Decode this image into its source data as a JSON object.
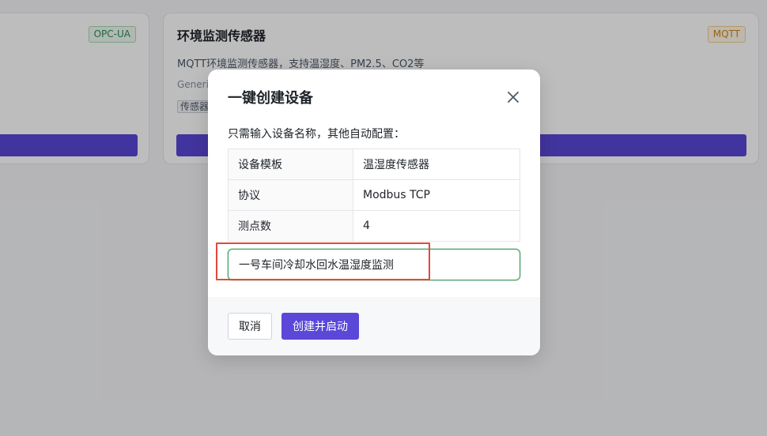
{
  "background_cards": [
    {
      "title": "",
      "badge": "OPC-UA"
    },
    {
      "title": "环境监测传感器",
      "badge": "MQTT",
      "description": "MQTT环境监测传感器，支持温湿度、PM2.5、CO2等",
      "vendor": "Generic",
      "tag": "传感器"
    }
  ],
  "modal": {
    "title": "一键创建设备",
    "close_icon": "close-icon",
    "hint": "只需输入设备名称，其他自动配置：",
    "info_rows": [
      {
        "key": "设备模板",
        "value": "温湿度传感器"
      },
      {
        "key": "协议",
        "value": "Modbus TCP"
      },
      {
        "key": "测点数",
        "value": "4"
      }
    ],
    "device_name_value": "一号车间冷却水回水温湿度监测",
    "cancel_label": "取消",
    "submit_label": "创建并启动"
  },
  "colors": {
    "primary": "#5b48d8",
    "input_focus": "#3a9d5d",
    "highlight": "#e04a3a",
    "badge_opc": "#2e8b57",
    "badge_mqtt": "#d0851c"
  }
}
